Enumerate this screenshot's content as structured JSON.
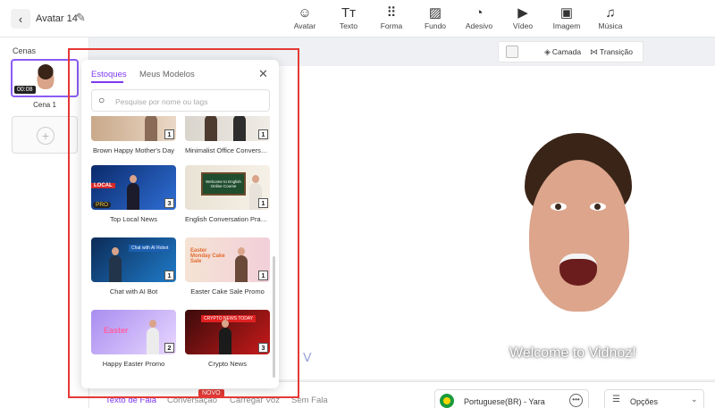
{
  "header": {
    "project_title": "Avatar 14",
    "tools": [
      {
        "label": "Avatar",
        "icon": "avatar-icon"
      },
      {
        "label": "Texto",
        "icon": "text-icon"
      },
      {
        "label": "Forma",
        "icon": "shapes-icon"
      },
      {
        "label": "Fundo",
        "icon": "background-icon"
      },
      {
        "label": "Adesivo",
        "icon": "sticker-icon"
      },
      {
        "label": "Vídeo",
        "icon": "video-icon"
      },
      {
        "label": "Imagem",
        "icon": "image-icon"
      },
      {
        "label": "Música",
        "icon": "music-icon"
      }
    ]
  },
  "scenes": {
    "title": "Cenas",
    "items": [
      {
        "label": "Cena 1",
        "duration": "00:08"
      }
    ]
  },
  "canvas_toolbar": {
    "layer_label": "Camada",
    "transition_label": "Transição"
  },
  "stage": {
    "caption": "Welcome to Vidnoz!"
  },
  "popup": {
    "tabs": [
      "Estoques",
      "Meus Modelos"
    ],
    "active_tab": "Estoques",
    "search_placeholder": "Pesquise por nome ou tags",
    "templates": [
      {
        "title": "Brown Happy Mother's Day",
        "count": "1"
      },
      {
        "title": "Minimalist Office Conversat...",
        "count": "1"
      },
      {
        "title": "Top Local News",
        "count": "3",
        "badge": "PRO",
        "tag": "LOCAL"
      },
      {
        "title": "English Conversation Practi...",
        "count": "1",
        "board_text": "Welcome to English Online Course"
      },
      {
        "title": "Chat with AI Bot",
        "count": "1",
        "banner_text": "Chat with AI Robot"
      },
      {
        "title": "Easter Cake Sale Promo",
        "count": "1",
        "banner_text": "Easter Monday Cake Sale"
      },
      {
        "title": "Happy Easter Promo",
        "count": "2",
        "banner_text": "Easter"
      },
      {
        "title": "Crypto News",
        "count": "3",
        "banner_text": "CRYPTO NEWS TODAY"
      }
    ]
  },
  "bottom": {
    "tabs": [
      "Texto de Fala",
      "Conversação",
      "Carregar Voz",
      "Sem Fala"
    ],
    "active_tab": "Texto de Fala",
    "new_badge": "NOVO",
    "language": "Portuguese(BR) - Yara",
    "options_label": "Opções"
  },
  "colors": {
    "accent": "#7c3aed",
    "highlight": "#e53935"
  }
}
